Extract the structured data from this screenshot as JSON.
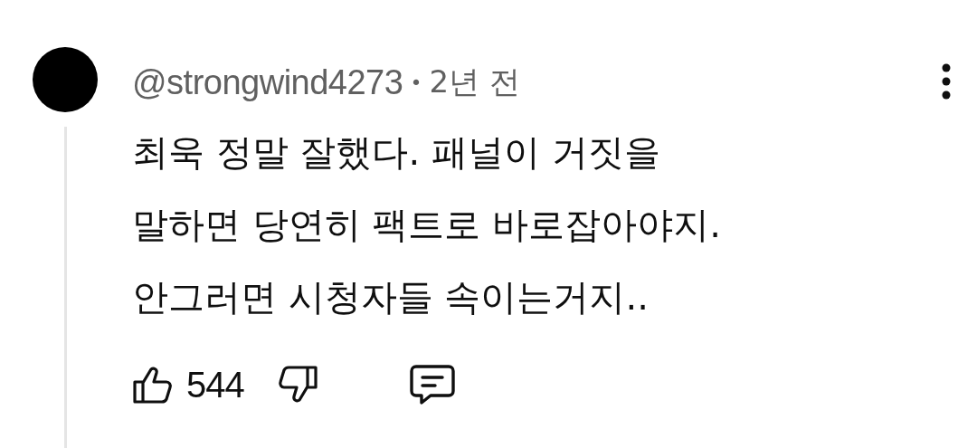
{
  "comment": {
    "author": "@strongwind4273",
    "separator": "•",
    "time": "2년 전",
    "text": "최욱 정말 잘했다. 패널이 거짓을\n말하면 당연히 팩트로 바로잡아야지.\n안그러면 시청자들 속이는거지..",
    "likes": "544"
  }
}
